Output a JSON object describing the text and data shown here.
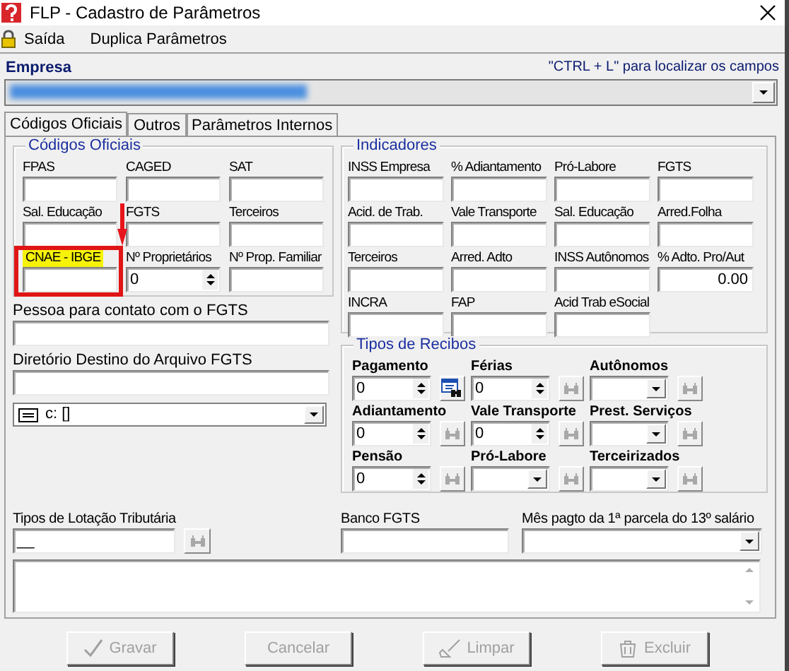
{
  "window": {
    "title": "FLP - Cadastro de Parâmetros"
  },
  "menu": [
    {
      "label": "Saída",
      "kind": "lock"
    },
    {
      "label": "Duplica Parâmetros",
      "kind": "none"
    }
  ],
  "empresa": {
    "label": "Empresa",
    "hint": "\"CTRL + L\" para localizar os campos",
    "redacted": true
  },
  "tabs": [
    {
      "label": "Códigos Oficiais",
      "selected": true
    },
    {
      "label": "Outros",
      "selected": false
    },
    {
      "label": "Parâmetros Internos",
      "selected": false
    }
  ],
  "codigos_oficiais": {
    "title": "Códigos Oficiais",
    "fields": [
      {
        "label": "FPAS",
        "kind": "text",
        "highlighted": false
      },
      {
        "label": "CAGED",
        "kind": "text",
        "highlighted": false
      },
      {
        "label": "SAT",
        "kind": "text",
        "highlighted": false
      },
      {
        "label": "Sal. Educação",
        "kind": "text",
        "highlighted": false
      },
      {
        "label": "FGTS",
        "kind": "text",
        "highlighted": false
      },
      {
        "label": "Terceiros",
        "kind": "text",
        "highlighted": false
      },
      {
        "label": "CNAE - IBGE",
        "kind": "text",
        "highlighted": true
      },
      {
        "label": "Nº Proprietários",
        "kind": "spinner",
        "value": "0",
        "highlighted": false
      },
      {
        "label": "Nº Prop. Familiar",
        "kind": "text",
        "highlighted": false
      }
    ]
  },
  "contato_fgts": {
    "label": "Pessoa para contato com o FGTS"
  },
  "diretorio_fgts": {
    "label": "Diretório Destino do Arquivo FGTS"
  },
  "drive": {
    "value": "c: []"
  },
  "indicadores": {
    "title": "Indicadores",
    "fields": [
      {
        "label": "INSS Empresa"
      },
      {
        "label": "% Adiantamento"
      },
      {
        "label": "Pró-Labore"
      },
      {
        "label": "FGTS"
      },
      {
        "label": "Acid. de Trab."
      },
      {
        "label": "Vale Transporte"
      },
      {
        "label": "Sal. Educação"
      },
      {
        "label": "Arred.Folha"
      },
      {
        "label": "Terceiros"
      },
      {
        "label": "Arred. Adto"
      },
      {
        "label": "INSS Autônomos"
      },
      {
        "label": "% Adto. Pro/Aut",
        "value": "0.00"
      },
      {
        "label": "INCRA"
      },
      {
        "label": "FAP"
      },
      {
        "label": "Acid Trab eSocial"
      }
    ]
  },
  "tipos_de_recibos": {
    "title": "Tipos de Recibos",
    "fields": [
      {
        "label": "Pagamento",
        "kind": "spinner",
        "value": "0",
        "lookup_enabled": true
      },
      {
        "label": "Férias",
        "kind": "spinner",
        "value": "0",
        "lookup_enabled": false
      },
      {
        "label": "Autônomos",
        "kind": "combo",
        "lookup_enabled": false
      },
      {
        "label": "Adiantamento",
        "kind": "spinner",
        "value": "0",
        "lookup_enabled": false
      },
      {
        "label": "Vale Transporte",
        "kind": "spinner",
        "value": "0",
        "lookup_enabled": false
      },
      {
        "label": "Prest. Serviços",
        "kind": "combo",
        "lookup_enabled": false
      },
      {
        "label": "Pensão",
        "kind": "spinner",
        "value": "0",
        "lookup_enabled": false
      },
      {
        "label": "Pró-Labore",
        "kind": "combo",
        "lookup_enabled": false
      },
      {
        "label": "Terceirizados",
        "kind": "combo",
        "lookup_enabled": false
      }
    ]
  },
  "lotacao": {
    "label": "Tipos de Lotação Tributária",
    "value": "__"
  },
  "banco_fgts": {
    "label": "Banco FGTS"
  },
  "mes_13": {
    "label": "Mês pagto da 1ª parcela do 13º salário"
  },
  "buttons": [
    {
      "label": "Gravar",
      "kind": "check",
      "disabled": true
    },
    {
      "label": "Cancelar",
      "kind": "none",
      "disabled": true
    },
    {
      "label": "Limpar",
      "kind": "broom",
      "disabled": true
    },
    {
      "label": "Excluir",
      "kind": "trash",
      "disabled": true
    }
  ]
}
